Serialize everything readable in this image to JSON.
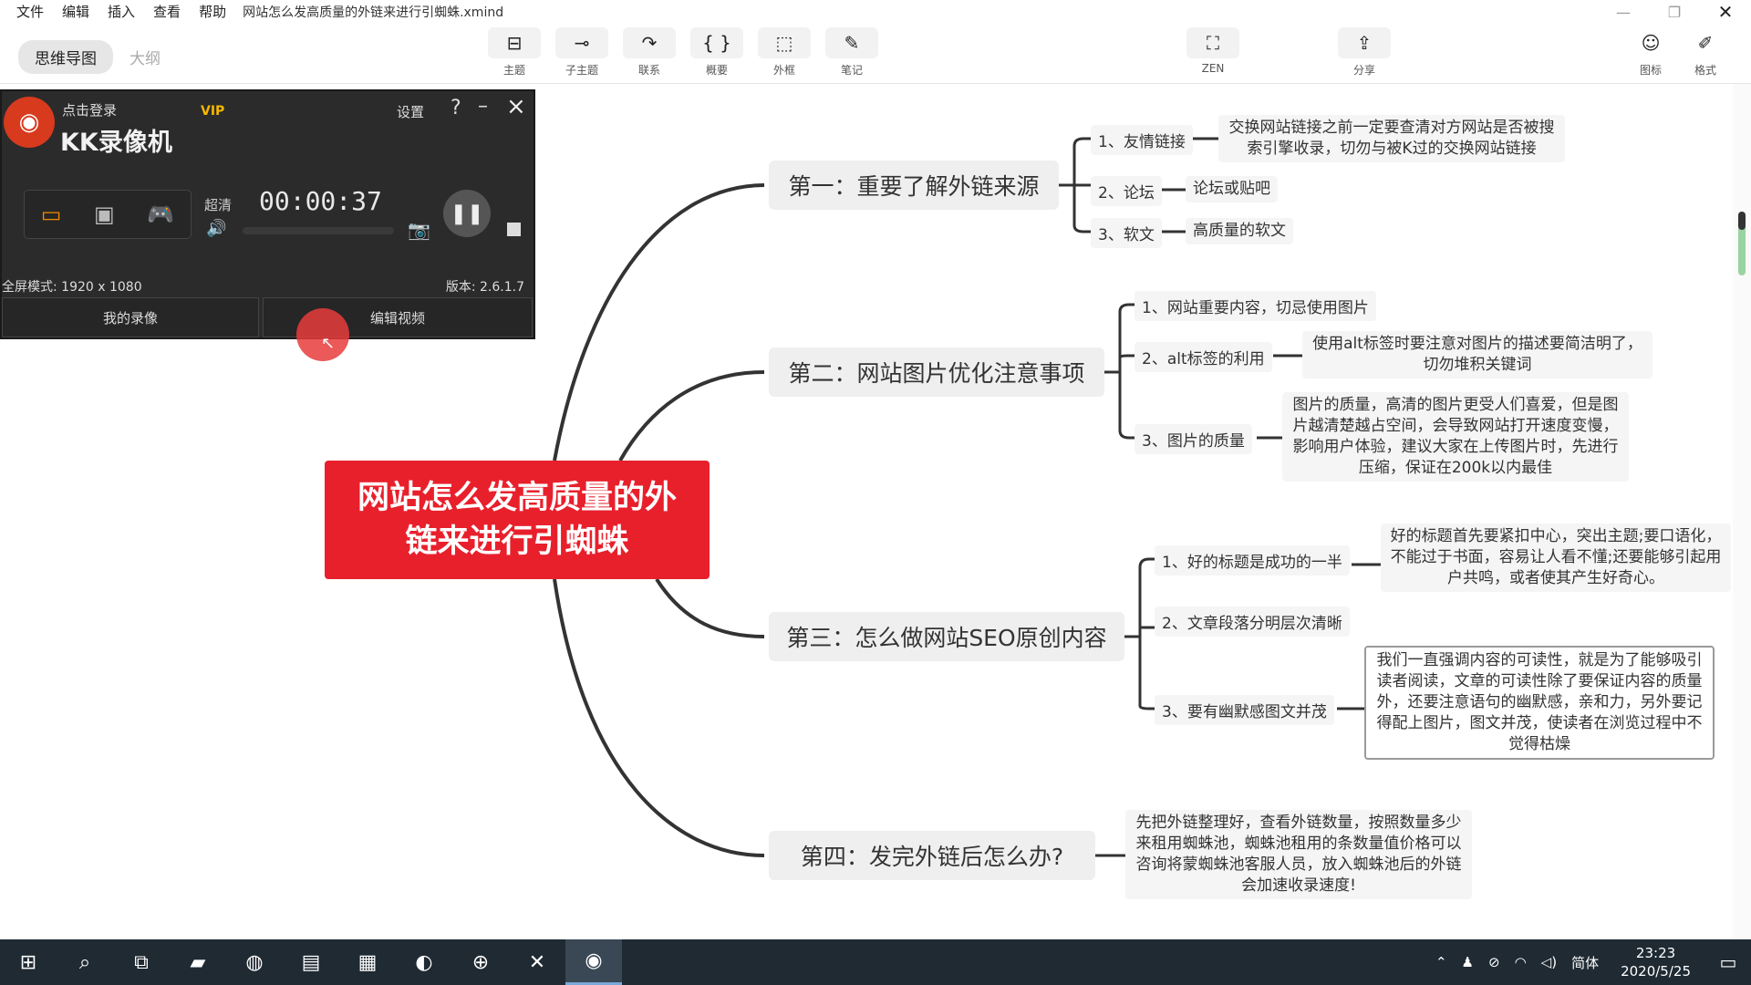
{
  "menubar": {
    "items": [
      "文件",
      "编辑",
      "插入",
      "查看",
      "帮助"
    ],
    "title": "网站怎么发高质量的外链来进行引蜘蛛.xmind",
    "controls": {
      "minimize": "—",
      "restore": "❐",
      "close": "✕"
    }
  },
  "toolbar": {
    "view_mindmap": "思维导图",
    "view_outline": "大纲",
    "tools": [
      {
        "label": "主题",
        "icon": "⊟"
      },
      {
        "label": "子主题",
        "icon": "⊸"
      },
      {
        "label": "联系",
        "icon": "↷"
      },
      {
        "label": "概要",
        "icon": "{ }"
      },
      {
        "label": "外框",
        "icon": "⬚"
      },
      {
        "label": "笔记",
        "icon": "✎"
      },
      {
        "label": "ZEN",
        "icon": "⛶"
      },
      {
        "label": "分享",
        "icon": "⇪"
      },
      {
        "label": "图标",
        "icon": "☺"
      },
      {
        "label": "格式",
        "icon": "✐"
      }
    ]
  },
  "mindmap": {
    "central": "网站怎么发高质量的外链来进行引蜘蛛",
    "topics": [
      {
        "title": "第一：重要了解外链来源",
        "subs": [
          {
            "label": "1、友情链接",
            "note": "交换网站链接之前一定要查清对方网站是否被搜索引擎收录，切勿与被K过的交换网站链接"
          },
          {
            "label": "2、论坛",
            "note": "论坛或贴吧"
          },
          {
            "label": "3、软文",
            "note": "高质量的软文"
          }
        ]
      },
      {
        "title": "第二：网站图片优化注意事项",
        "subs": [
          {
            "label": "1、网站重要内容，切忌使用图片",
            "note": ""
          },
          {
            "label": "2、alt标签的利用",
            "note": "使用alt标签时要注意对图片的描述要简洁明了，切勿堆积关键词"
          },
          {
            "label": "3、图片的质量",
            "note": "图片的质量，高清的图片更受人们喜爱，但是图片越清楚越占空间，会导致网站打开速度变慢，影响用户体验，建议大家在上传图片时，先进行压缩，保证在200k以内最佳"
          }
        ]
      },
      {
        "title": "第三：怎么做网站SEO原创内容",
        "subs": [
          {
            "label": "1、好的标题是成功的一半",
            "note": "好的标题首先要紧扣中心，突出主题;要口语化，不能过于书面，容易让人看不懂;还要能够引起用户共鸣，或者使其产生好奇心。"
          },
          {
            "label": "2、文章段落分明层次清晰",
            "note": ""
          },
          {
            "label": "3、要有幽默感图文并茂",
            "note": "我们一直强调内容的可读性，就是为了能够吸引读者阅读，文章的可读性除了要保证内容的质量外，还要注意语句的幽默感，亲和力，另外要记得配上图片，图文并茂，使读者在浏览过程中不觉得枯燥"
          }
        ]
      },
      {
        "title": "第四：发完外链后怎么办?",
        "note": "先把外链整理好，查看外链数量，按照数量多少来租用蜘蛛池，蜘蛛池租用的条数量值价格可以咨询将蒙蜘蛛池客服人员，放入蜘蛛池后的外链会加速收录速度!"
      }
    ]
  },
  "recorder": {
    "login": "点击登录",
    "vip": "VIP",
    "title": "KK录像机",
    "settings": "设置",
    "help": "?",
    "quality": "超清",
    "time": "00:00:37",
    "fullscreen": "全屏模式: 1920 x 1080",
    "version": "版本: 2.6.1.7",
    "my_recordings": "我的录像",
    "edit_video": "编辑视频"
  },
  "taskbar": {
    "lang": "简体",
    "time": "23:23",
    "date": "2020/5/25"
  },
  "colors": {
    "central": "#e8202c",
    "topic_bg": "#efefef",
    "line": "#333333",
    "recorder_bg": "#2b2b2b",
    "taskbar_bg": "#1f2a33"
  }
}
